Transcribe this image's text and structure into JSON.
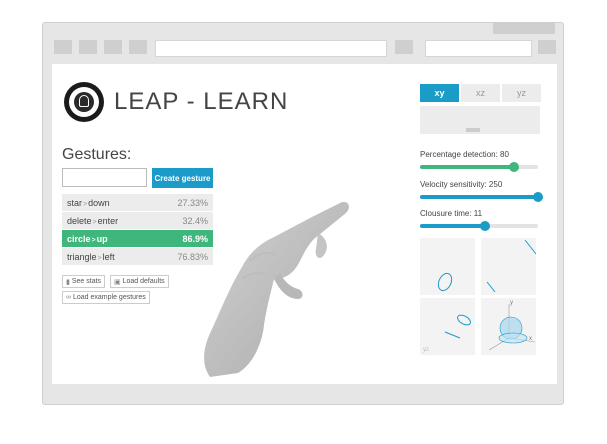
{
  "app": {
    "title": "LEAP - LEARN"
  },
  "gestures": {
    "heading": "Gestures:",
    "input_placeholder": "",
    "create_label": "Create gesture",
    "items": [
      {
        "from": "star",
        "sep": ">",
        "to": "down",
        "pct": "27.33%",
        "active": false
      },
      {
        "from": "delete",
        "sep": ">",
        "to": "enter",
        "pct": "32.4%",
        "active": false
      },
      {
        "from": "circle",
        "sep": ">",
        "to": "up",
        "pct": "86.9%",
        "active": true
      },
      {
        "from": "triangle",
        "sep": ">",
        "to": "left",
        "pct": "76.83%",
        "active": false
      }
    ],
    "actions": {
      "see_stats": "See stats",
      "load_defaults": "Load defaults",
      "load_examples": "Load example gestures"
    }
  },
  "tabs": [
    {
      "label": "xy",
      "selected": true
    },
    {
      "label": "xz",
      "selected": false
    },
    {
      "label": "yz",
      "selected": false
    }
  ],
  "settings": {
    "percentage": {
      "label": "Percentage detection: 80",
      "value": 80,
      "max": 100,
      "color": "#3fb67b"
    },
    "velocity": {
      "label": "Velocity sensitivity: 250",
      "value": 250,
      "max": 250,
      "color": "#1a9bc8"
    },
    "closure": {
      "label": "Clousure time: 11",
      "value": 11,
      "max": 20,
      "color": "#1a9bc8"
    }
  },
  "views": {
    "axis_y": "y",
    "axis_x": "x",
    "xz_label": "xz",
    "yz_label": "yz"
  },
  "colors": {
    "accent": "#1a9bc8",
    "success": "#3fb67b"
  }
}
